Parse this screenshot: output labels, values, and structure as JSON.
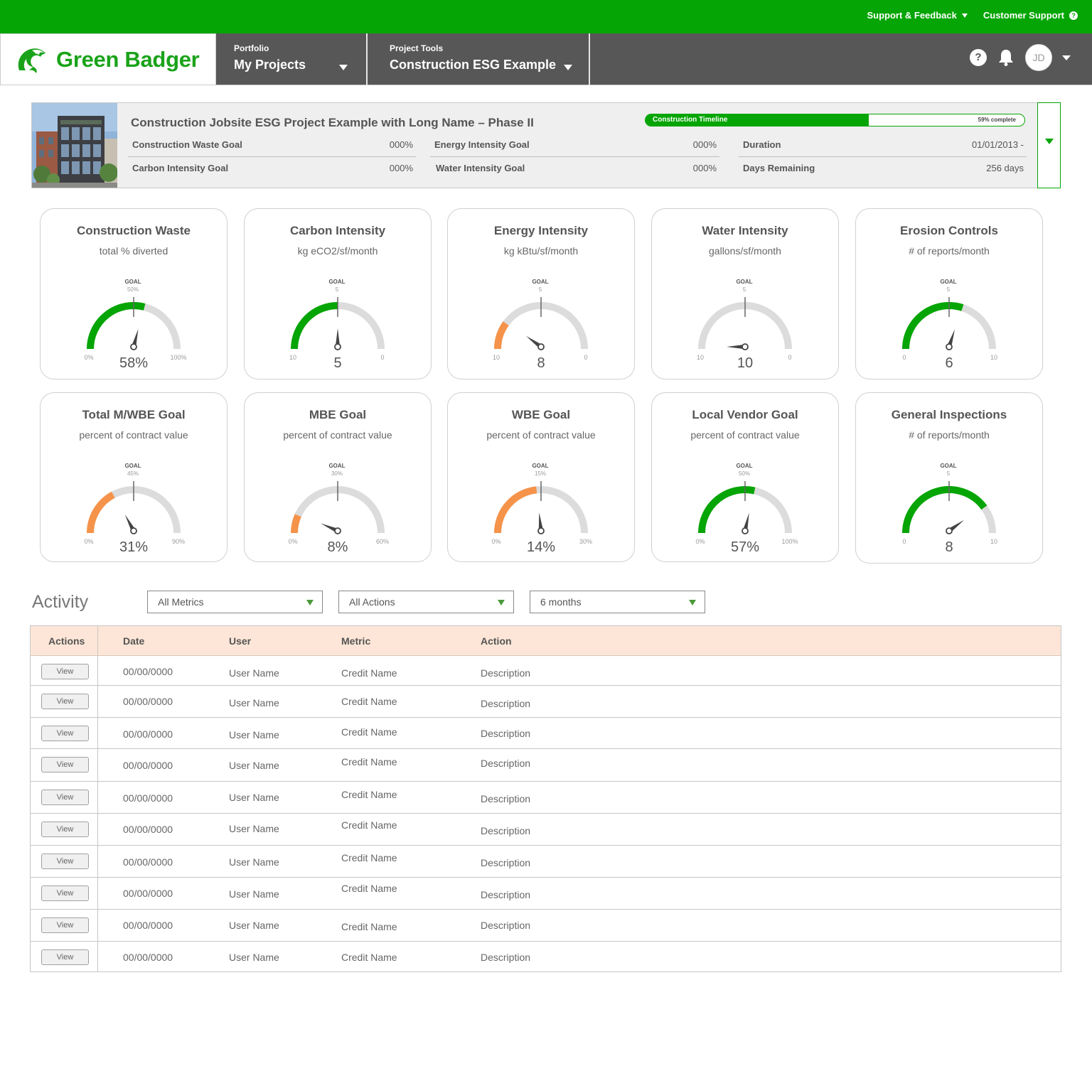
{
  "topbar": {
    "support_feedback": "Support & Feedback",
    "customer_support": "Customer Support",
    "color": "#05a505"
  },
  "brand": {
    "name": "Green Badger",
    "color": "#1aa31a"
  },
  "header": {
    "portfolio": {
      "label": "Portfolio",
      "value": "My Projects"
    },
    "project_tools": {
      "label": "Project Tools",
      "value": "Construction ESG Example"
    },
    "user_initials": "JD"
  },
  "project": {
    "title": "Construction Jobsite ESG Project Example with Long Name – Phase II",
    "timeline": {
      "label": "Construction Timeline",
      "progress": 0.59,
      "progress_text": "59% complete"
    },
    "goals": [
      {
        "key": "Construction Waste Goal",
        "value": "000%"
      },
      {
        "key": "Carbon Intensity Goal",
        "value": "000%"
      },
      {
        "key": "Energy Intensity Goal",
        "value": "000%"
      },
      {
        "key": "Water Intensity Goal",
        "value": "000%"
      },
      {
        "key": "Duration",
        "value": "01/01/2013 -"
      },
      {
        "key": "Days Remaining",
        "value": "256 days"
      }
    ]
  },
  "gauges": [
    {
      "title": "Construction Waste",
      "subtitle": "total % diverted",
      "goal_label": "GOAL",
      "goal_value": "50%",
      "min_label": "0%",
      "max_label": "100%",
      "value_text": "58%",
      "fill": 0.58,
      "goal_frac": 0.5,
      "color": "#05a505"
    },
    {
      "title": "Carbon Intensity",
      "subtitle": "kg eCO2/sf/month",
      "goal_label": "GOAL",
      "goal_value": "5",
      "min_label": "10",
      "max_label": "0",
      "value_text": "5",
      "fill": 0.5,
      "goal_frac": 0.5,
      "color": "#05a505"
    },
    {
      "title": "Energy Intensity",
      "subtitle": "kg kBtu/sf/month",
      "goal_label": "GOAL",
      "goal_value": "5",
      "min_label": "10",
      "max_label": "0",
      "value_text": "8",
      "fill": 0.2,
      "goal_frac": 0.5,
      "color": "#f5934a"
    },
    {
      "title": "Water Intensity",
      "subtitle": "gallons/sf/month",
      "goal_label": "GOAL",
      "goal_value": "5",
      "min_label": "10",
      "max_label": "0",
      "value_text": "10",
      "fill": 0.0,
      "goal_frac": 0.5,
      "color": "#05a505"
    },
    {
      "title": "Erosion Controls",
      "subtitle": "# of reports/month",
      "goal_label": "GOAL",
      "goal_value": "5",
      "min_label": "0",
      "max_label": "10",
      "value_text": "6",
      "fill": 0.6,
      "goal_frac": 0.5,
      "color": "#05a505"
    },
    {
      "title": "Total M/WBE Goal",
      "subtitle": "percent of contract value",
      "goal_label": "GOAL",
      "goal_value": "45%",
      "min_label": "0%",
      "max_label": "90%",
      "value_text": "31%",
      "fill": 0.344,
      "goal_frac": 0.5,
      "color": "#f5934a"
    },
    {
      "title": "MBE Goal",
      "subtitle": "percent of contract value",
      "goal_label": "GOAL",
      "goal_value": "30%",
      "min_label": "0%",
      "max_label": "60%",
      "value_text": "8%",
      "fill": 0.133,
      "goal_frac": 0.5,
      "color": "#f5934a"
    },
    {
      "title": "WBE Goal",
      "subtitle": "percent of contract value",
      "goal_label": "GOAL",
      "goal_value": "15%",
      "min_label": "0%",
      "max_label": "30%",
      "value_text": "14%",
      "fill": 0.467,
      "goal_frac": 0.5,
      "color": "#f5934a"
    },
    {
      "title": "Local Vendor Goal",
      "subtitle": "percent of contract value",
      "goal_label": "GOAL",
      "goal_value": "50%",
      "min_label": "0%",
      "max_label": "100%",
      "value_text": "57%",
      "fill": 0.57,
      "goal_frac": 0.5,
      "color": "#05a505"
    },
    {
      "title": "General Inspections",
      "subtitle": "# of reports/month",
      "goal_label": "GOAL",
      "goal_value": "5",
      "min_label": "0",
      "max_label": "10",
      "value_text": "8",
      "fill": 0.8,
      "goal_frac": 0.5,
      "color": "#05a505"
    }
  ],
  "activity": {
    "title": "Activity",
    "filters": [
      {
        "value": "All Metrics"
      },
      {
        "value": "All Actions"
      },
      {
        "value": "6 months"
      }
    ],
    "columns": [
      "Actions",
      "Date",
      "User",
      "Metric",
      "Action"
    ],
    "view_label": "View",
    "rows": [
      {
        "date": "00/00/0000",
        "user": "User Name",
        "metric": "Credit Name",
        "action": "Description"
      },
      {
        "date": "00/00/0000",
        "user": "User Name",
        "metric": "Credit Name",
        "action": "Description"
      },
      {
        "date": "00/00/0000",
        "user": "User Name",
        "metric": "Credit Name",
        "action": "Description"
      },
      {
        "date": "00/00/0000",
        "user": "User Name",
        "metric": "Credit Name",
        "action": "Description"
      },
      {
        "date": "00/00/0000",
        "user": "User Name",
        "metric": "Credit Name",
        "action": "Description"
      },
      {
        "date": "00/00/0000",
        "user": "User Name",
        "metric": "Credit Name",
        "action": "Description"
      },
      {
        "date": "00/00/0000",
        "user": "User Name",
        "metric": "Credit Name",
        "action": "Description"
      },
      {
        "date": "00/00/0000",
        "user": "User Name",
        "metric": "Credit Name",
        "action": "Description"
      },
      {
        "date": "00/00/0000",
        "user": "User Name",
        "metric": "Credit Name",
        "action": "Description"
      },
      {
        "date": "00/00/0000",
        "user": "User Name",
        "metric": "Credit Name",
        "action": "Description"
      }
    ]
  }
}
